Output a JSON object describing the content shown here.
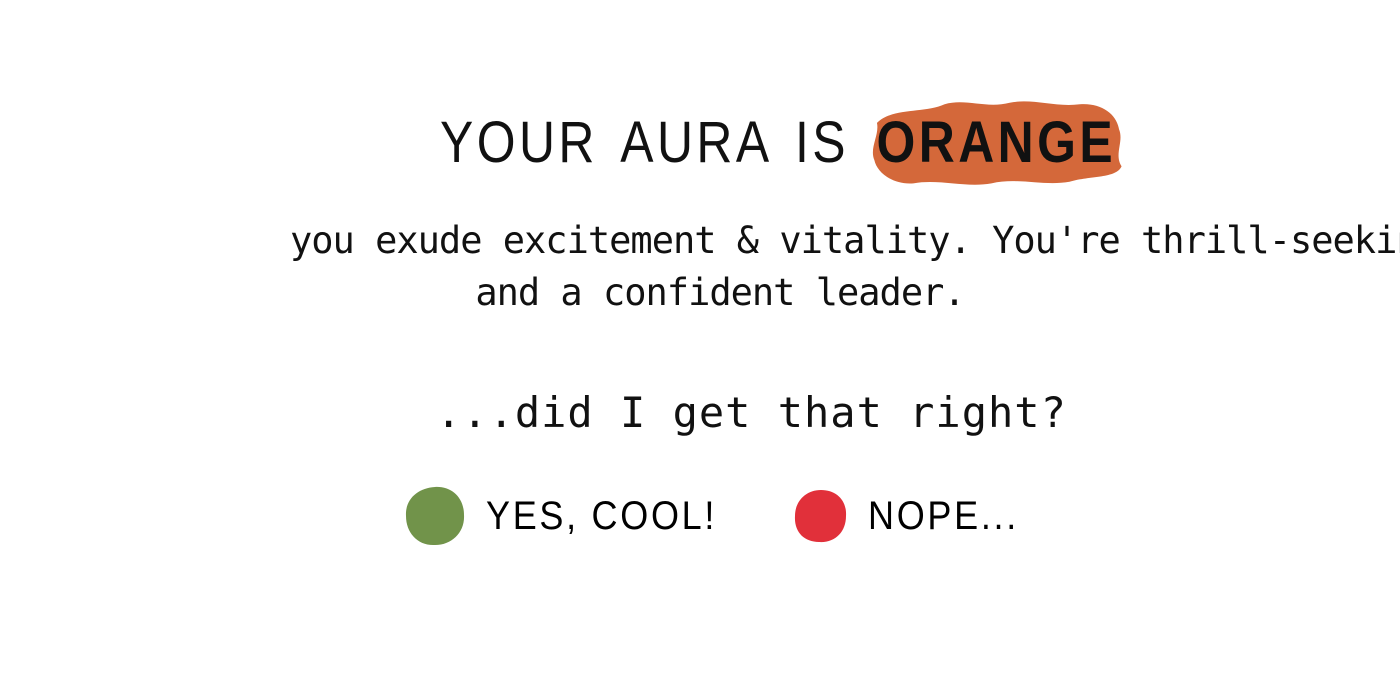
{
  "result": {
    "prefix_word1": "YOUR",
    "prefix_word2": "AURA",
    "prefix_word3": "IS",
    "color_name": "ORANGE",
    "highlight_color": "#D4683A"
  },
  "description": {
    "line1": "you exude excitement & vitality. You're thrill-seeking",
    "line2": "and a confident leader."
  },
  "prompt": {
    "question": "...did I get that right?"
  },
  "choices": {
    "yes_label": "YES, COOL!",
    "yes_color": "#71934A",
    "no_label": "NOPE...",
    "no_color": "#E1303A"
  }
}
